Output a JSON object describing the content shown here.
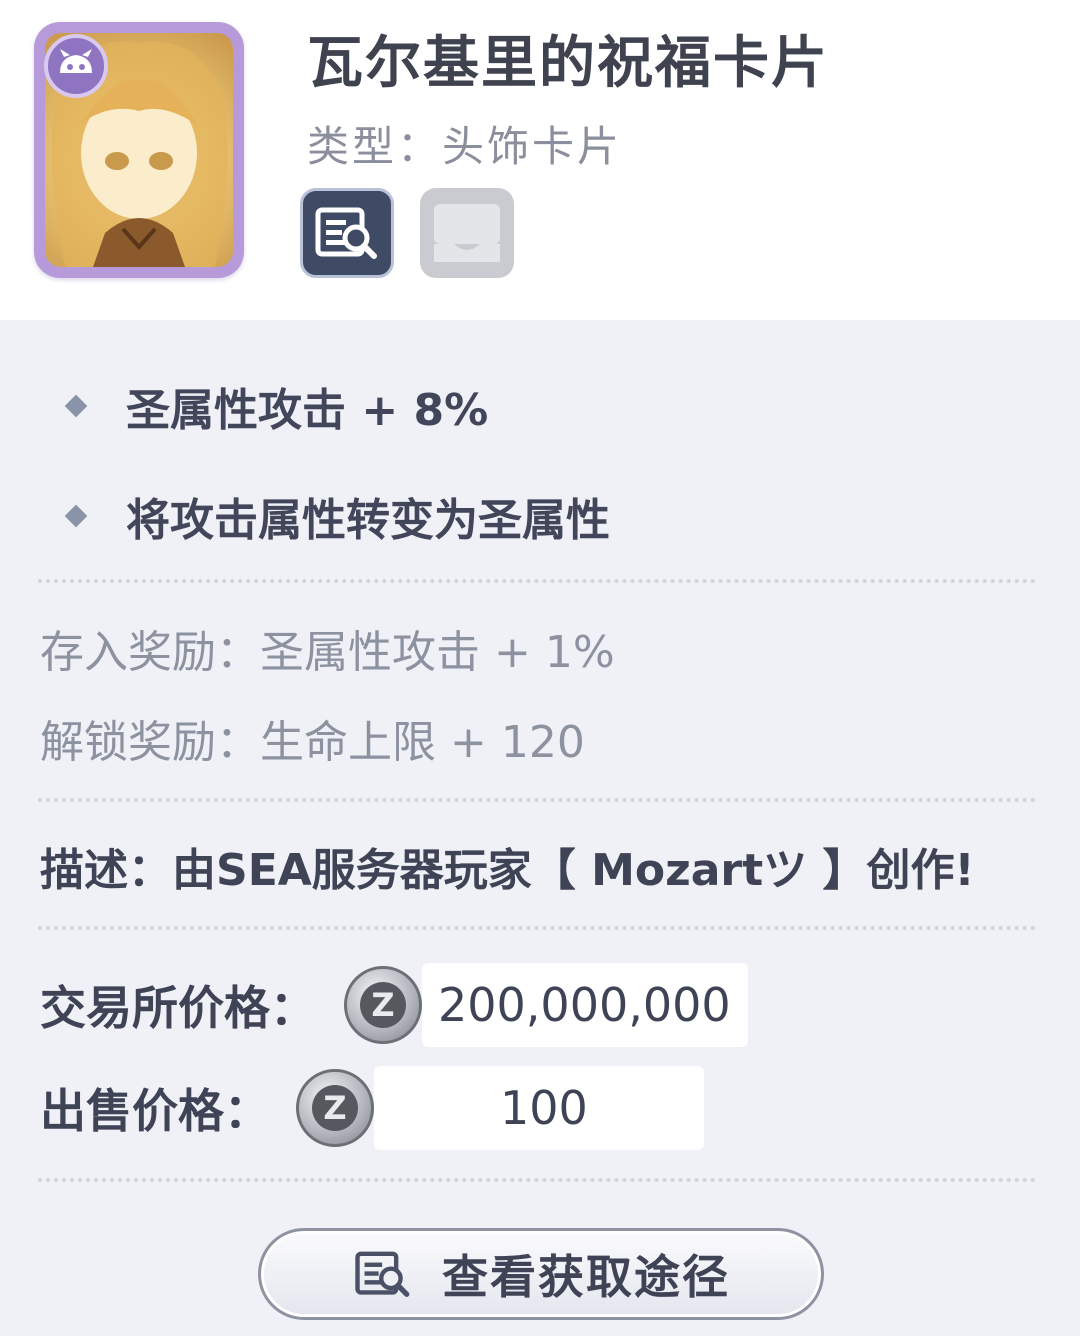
{
  "item": {
    "name": "瓦尔基里的祝福卡片",
    "type_line": "类型：头饰卡片"
  },
  "header_icons": [
    {
      "icon": "card-info-icon",
      "state": "active"
    },
    {
      "icon": "card-slot-icon",
      "state": "inactive"
    }
  ],
  "effects": [
    "圣属性攻击 + 8%",
    "将攻击属性转变为圣属性"
  ],
  "bonuses": {
    "deposit": "存入奖励：圣属性攻击 + 1%",
    "unlock": "解锁奖励：生命上限 + 120"
  },
  "description": "描述：由SEA服务器玩家【 Mozartツ 】创作!",
  "prices": {
    "exchange_label": "交易所价格：",
    "exchange_value": "200,000,000",
    "sell_label": "出售价格：",
    "sell_value": "100",
    "coin_glyph": "Z"
  },
  "actions": {
    "view_source_label": "查看获取途径"
  },
  "colors": {
    "panel_bg": "#eff1f6",
    "card_frame": "#b79ad9",
    "active_icon_bg": "#3f4a64",
    "inactive_icon_bg": "#c9cbd1"
  }
}
